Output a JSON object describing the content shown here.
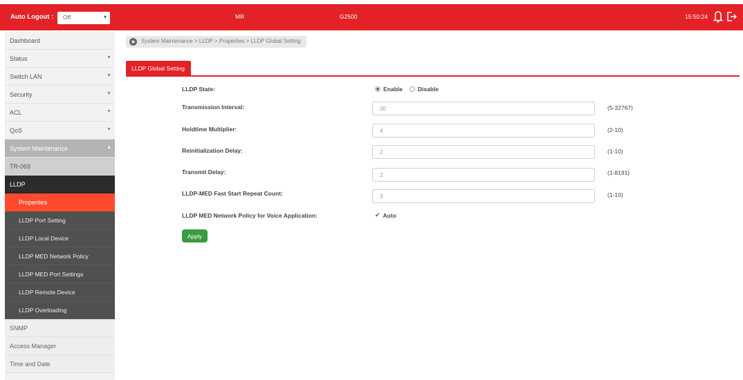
{
  "topbar": {
    "auto_logout_label": "Auto Logout :",
    "auto_logout_value": "Off",
    "model_mr": "MR",
    "model_name": "G2500",
    "clock": "15:50:24",
    "bell_icon": "bell-icon",
    "logout_icon": "logout-icon",
    "chevron_icon": "chevron-down-icon"
  },
  "sidebar": {
    "items": [
      {
        "label": "Dashboard"
      },
      {
        "label": "Status"
      },
      {
        "label": "Switch LAN"
      },
      {
        "label": "Security"
      },
      {
        "label": "ACL"
      },
      {
        "label": "QoS"
      },
      {
        "label": "System Maintenance"
      },
      {
        "label": "TR-069"
      },
      {
        "label": "LLDP"
      },
      {
        "label": "Properties"
      },
      {
        "label": "LLDP Port Setting"
      },
      {
        "label": "LLDP Local Device"
      },
      {
        "label": "LLDP MED Network Policy"
      },
      {
        "label": "LLDP MED Port Settings"
      },
      {
        "label": "LLDP Remote Device"
      },
      {
        "label": "LLDP Overloading"
      },
      {
        "label": "SNMP"
      },
      {
        "label": "Access Manager"
      },
      {
        "label": "Time and Date"
      }
    ]
  },
  "breadcrumb": {
    "text": "System Maintenance > LLDP > Properties > LLDP Global Setting",
    "icon": "location-icon"
  },
  "tab": {
    "label": "LLDP Global Setting"
  },
  "form": {
    "lldp_state": {
      "label": "LLDP State:",
      "enable": "Enable",
      "disable": "Disable",
      "selected": "Enable"
    },
    "transmission_interval": {
      "label": "Transmission Interval:",
      "value": "30",
      "range": "(5-32767)"
    },
    "holdtime_multiplier": {
      "label": "Holdtime Multiplier:",
      "value": "4",
      "range": "(2-10)"
    },
    "reinit_delay": {
      "label": "Reinitialization Delay:",
      "value": "2",
      "range": "(1-10)"
    },
    "transmit_delay": {
      "label": "Transmit Delay:",
      "value": "2",
      "range": "(1-8191)"
    },
    "med_fast_start": {
      "label": "LLDP-MED Fast Start Repeat Count:",
      "value": "3",
      "range": "(1-10)"
    },
    "med_voice_policy": {
      "label": "LLDP MED Network Policy for Voice Application:",
      "option": "Auto",
      "checked": true
    },
    "apply_label": "Apply"
  }
}
